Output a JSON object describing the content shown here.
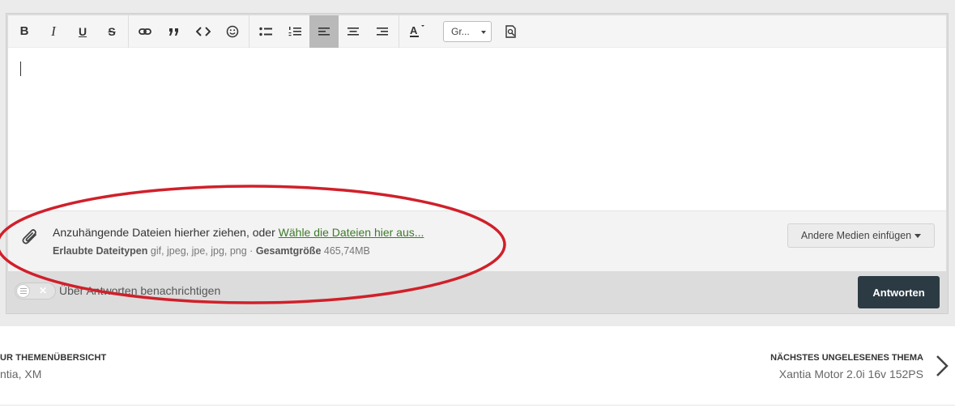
{
  "toolbar": {
    "bold": "B",
    "italic": "I",
    "underline": "U",
    "strike": "S",
    "font_select": "Gr...",
    "icons": [
      "bold-icon",
      "italic-icon",
      "underline-icon",
      "strikethrough-icon",
      "link-icon",
      "quote-icon",
      "code-icon",
      "smiley-icon",
      "bullet-list-icon",
      "numbered-list-icon",
      "align-left-icon",
      "align-center-icon",
      "align-right-icon",
      "text-color-icon",
      "preview-icon"
    ]
  },
  "attachments": {
    "drop_text": "Anzuhängende Dateien hierher ziehen, oder ",
    "choose_link": "Wähle die Dateien hier aus...",
    "allowed_label": "Erlaubte Dateitypen",
    "allowed_types": " gif, jpeg, jpe, jpg, png · ",
    "total_label": "Gesamtgröße",
    "total_value": " 465,74MB",
    "media_button": "Andere Medien einfügen"
  },
  "footer": {
    "notify_label": "Über Antworten benachrichtigen",
    "reply_button": "Antworten"
  },
  "nav": {
    "left_head": "UR THEMENÜBERSICHT",
    "left_sub": "ntia, XM",
    "right_head": "NÄCHSTES UNGELESENES THEMA",
    "right_sub": "Xantia Motor 2.0i 16v 152PS"
  },
  "colors": {
    "annotation": "#d0202a",
    "reply_button": "#2c3a43",
    "link": "#3d7a2a"
  }
}
